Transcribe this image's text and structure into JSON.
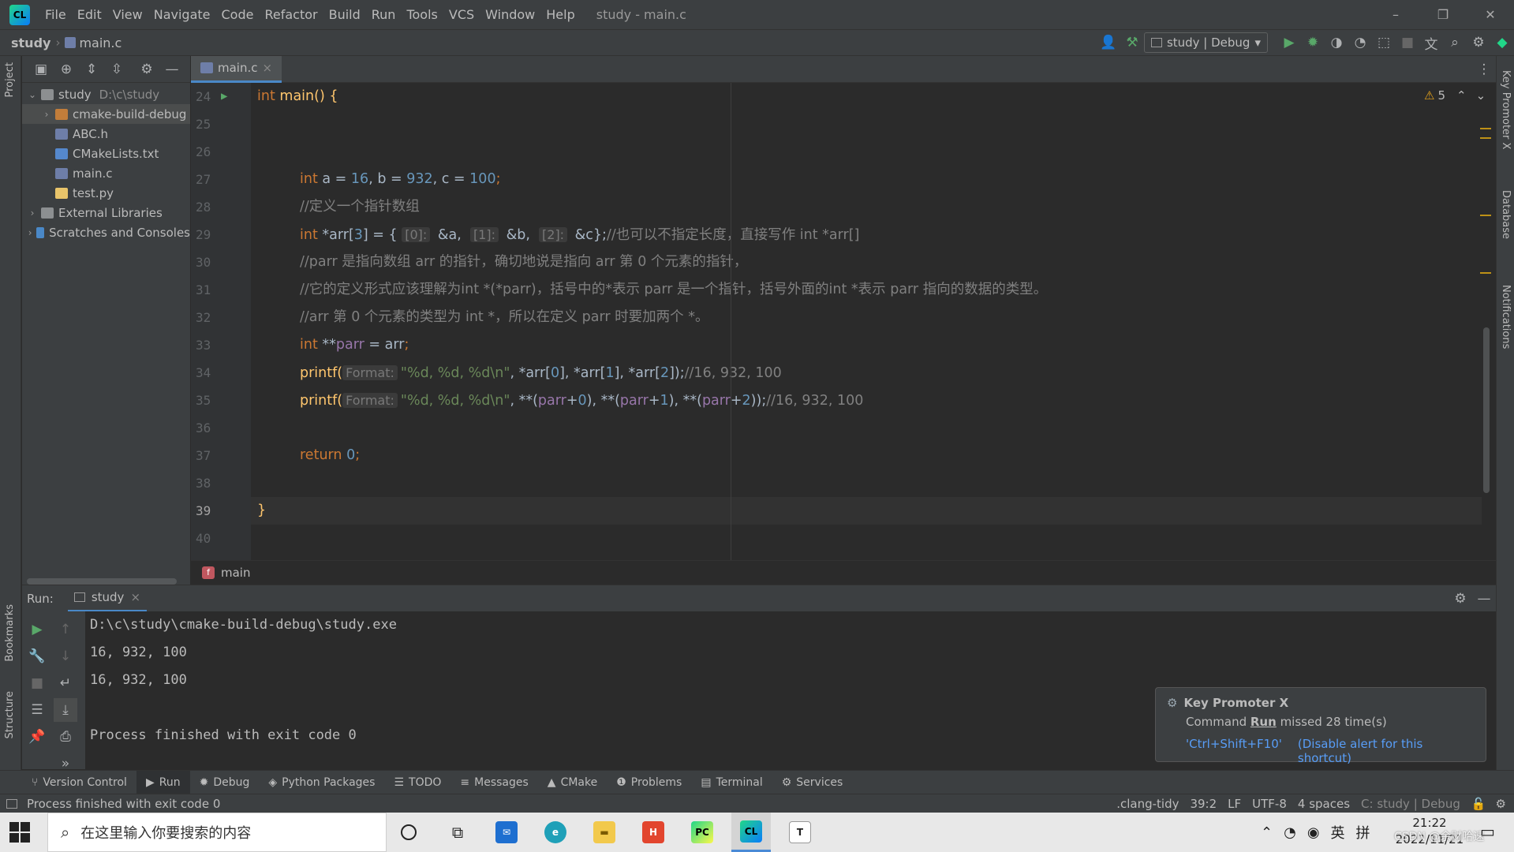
{
  "menu": [
    "File",
    "Edit",
    "View",
    "Navigate",
    "Code",
    "Refactor",
    "Build",
    "Run",
    "Tools",
    "VCS",
    "Window",
    "Help"
  ],
  "window_title": "study - main.c",
  "window_buttons": {
    "minimize": "–",
    "restore": "❐",
    "close": "✕"
  },
  "breadcrumb": {
    "project": "study",
    "file": "main.c"
  },
  "run_config": "study | Debug",
  "left_stripe": {
    "project": "Project",
    "bookmarks": "Bookmarks",
    "structure": "Structure"
  },
  "right_stripe": {
    "key_promoter": "Key Promoter X",
    "database": "Database",
    "notifications": "Notifications"
  },
  "project_tree": [
    {
      "name": "study",
      "extra": "D:\\c\\study",
      "indent": 0,
      "arrow": "v",
      "icon": "folder"
    },
    {
      "name": "cmake-build-debug",
      "extra": "",
      "indent": 1,
      "arrow": ">",
      "icon": "folder-orange"
    },
    {
      "name": "ABC.h",
      "extra": "",
      "indent": 1,
      "arrow": "",
      "icon": "h-file"
    },
    {
      "name": "CMakeLists.txt",
      "extra": "",
      "indent": 1,
      "arrow": "",
      "icon": "cmake-file"
    },
    {
      "name": "main.c",
      "extra": "",
      "indent": 1,
      "arrow": "",
      "icon": "c-file"
    },
    {
      "name": "test.py",
      "extra": "",
      "indent": 1,
      "arrow": "",
      "icon": "py-file"
    },
    {
      "name": "External Libraries",
      "extra": "",
      "indent": 0,
      "arrow": ">",
      "icon": "libs"
    },
    {
      "name": "Scratches and Consoles",
      "extra": "",
      "indent": 0,
      "arrow": ">",
      "icon": "scratch"
    }
  ],
  "editor_tab": {
    "label": "main.c",
    "close": "×"
  },
  "line_numbers": [
    "24",
    "25",
    "26",
    "27",
    "28",
    "29",
    "30",
    "31",
    "32",
    "33",
    "34",
    "35",
    "36",
    "37",
    "38",
    "39",
    "40"
  ],
  "code": {
    "l24": [
      "int",
      " main() {"
    ],
    "l27": [
      "int",
      " a = ",
      "16",
      ", b = ",
      "932",
      ", c = ",
      "100",
      ";"
    ],
    "l28": "//定义一个指针数组",
    "l29": [
      "int",
      " *arr[",
      "3",
      "] = { ",
      "[0]:",
      " &a,  ",
      "[1]:",
      " &b,  ",
      "[2]:",
      " &c};",
      "//也可以不指定长度，直接写作 int *arr[]"
    ],
    "l30": "//parr 是指向数组 arr 的指针，确切地说是指向 arr 第 0 个元素的指针，",
    "l31": "//它的定义形式应该理解为int *(*parr)，括号中的*表示 parr 是一个指针，括号外面的int *表示 parr 指向的数据的类型。",
    "l32": "//arr 第 0 个元素的类型为 int *，所以在定义 parr 时要加两个 *。",
    "l33": [
      "int",
      " **",
      "parr",
      " = ",
      "arr",
      ";"
    ],
    "l34": [
      "printf(",
      "Format:",
      "\"%d, %d, %d\\n\"",
      ", *arr[",
      "0",
      "], *arr[",
      "1",
      "], *arr[",
      "2",
      "]);",
      "//16, 932, 100"
    ],
    "l35": [
      "printf(",
      "Format:",
      "\"%d, %d, %d\\n\"",
      ", **(",
      "parr",
      "+",
      "0",
      "), **(",
      "parr",
      "+",
      "1",
      "), **(",
      "parr",
      "+",
      "2",
      "));",
      "//16, 932, 100"
    ],
    "l37": [
      "return",
      " ",
      "0",
      ";"
    ],
    "l39": "}"
  },
  "warnings": {
    "count": "5"
  },
  "editor_breadcrumb": {
    "badge": "f",
    "label": "main"
  },
  "run_panel": {
    "label": "Run:",
    "tab": "study",
    "tab_close": "×"
  },
  "run_output": [
    "D:\\c\\study\\cmake-build-debug\\study.exe",
    "16, 932, 100",
    "16, 932, 100",
    "",
    "Process finished with exit code 0"
  ],
  "notification": {
    "title": "Key Promoter X",
    "body_prefix": "Command ",
    "body_cmd": "Run",
    "body_suffix": " missed 28 time(s)",
    "link1": "'Ctrl+Shift+F10'",
    "link2": "(Disable alert for this shortcut)"
  },
  "toolwindows": [
    "Version Control",
    "Run",
    "Debug",
    "Python Packages",
    "TODO",
    "Messages",
    "CMake",
    "Problems",
    "Terminal",
    "Services"
  ],
  "status": {
    "message": "Process finished with exit code 0",
    "linter": ".clang-tidy",
    "position": "39:2",
    "line_sep": "LF",
    "encoding": "UTF-8",
    "indent": "4 spaces",
    "context": "C: study | Debug"
  },
  "taskbar": {
    "search_placeholder": "在这里输入你要搜索的内容",
    "ime": "英",
    "time": "21:22",
    "date": "2022/11/21",
    "watermark": "CSDN @余财哈速"
  },
  "colors": {
    "accent": "#4a88c7",
    "keyword": "#cc7832",
    "number": "#6897bb",
    "comment": "#808080",
    "string": "#6a8759",
    "function": "#ffc66d",
    "link": "#589df6",
    "run_green": "#59a869"
  }
}
